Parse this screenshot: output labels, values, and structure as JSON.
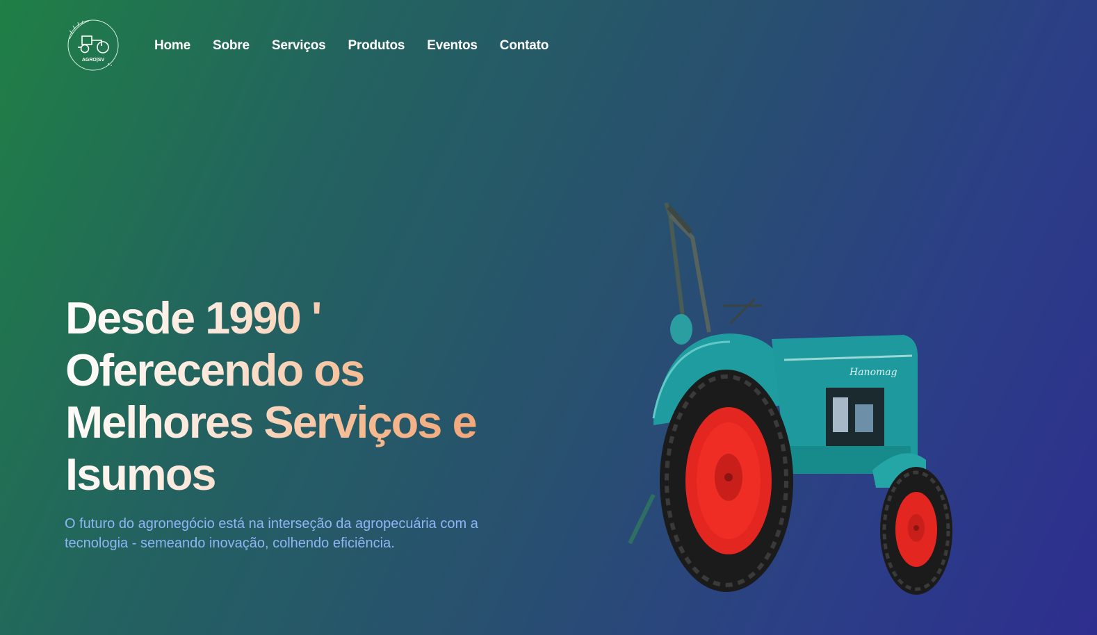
{
  "brand": {
    "logo_text": "AGRO|SV"
  },
  "nav": {
    "items": [
      {
        "label": "Home"
      },
      {
        "label": "Sobre"
      },
      {
        "label": "Serviços"
      },
      {
        "label": "Produtos"
      },
      {
        "label": "Eventos"
      },
      {
        "label": "Contato"
      }
    ]
  },
  "hero": {
    "title_lines": [
      "Desde 1990 '",
      "Oferecendo os",
      "Melhores Serviços e",
      "Isumos"
    ],
    "subtitle_line1": "O futuro do agronegócio está na interseção da agropecuária com a",
    "subtitle_line2": "tecnologia - semeando inovação, colhendo eficiência.",
    "tractor_badge": "Hanomag",
    "image_icon": "tractor-image"
  },
  "colors": {
    "gradient_start": "#1f7f45",
    "gradient_end": "#2e2e8e",
    "title_warm": "#f2a070",
    "subtitle": "#8fb5f5",
    "tractor_body": "#1f9aa0",
    "wheel_rim": "#e8261f"
  }
}
